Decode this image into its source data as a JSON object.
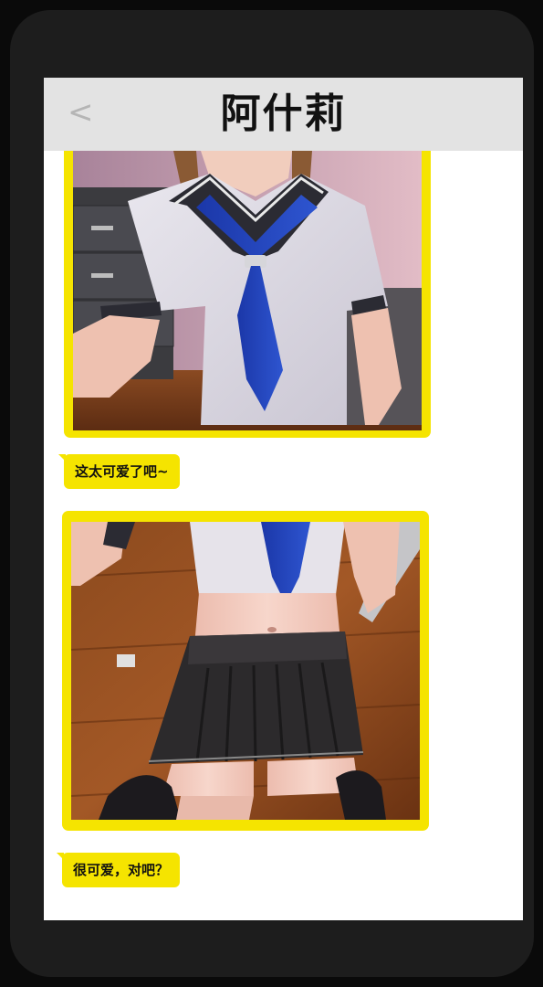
{
  "header": {
    "back_label": "<",
    "title": "阿什莉"
  },
  "messages": [
    {
      "type": "image",
      "icon": "photo-uniform-top"
    },
    {
      "type": "text",
      "text": "这太可爱了吧~"
    },
    {
      "type": "image",
      "icon": "photo-uniform-skirt"
    },
    {
      "type": "text",
      "text": "很可爱，对吧？"
    }
  ],
  "colors": {
    "accent": "#f5e400",
    "header_bg": "#e3e3e3",
    "phone_frame": "#1d1d1d",
    "screen_bg": "#ffffff"
  }
}
